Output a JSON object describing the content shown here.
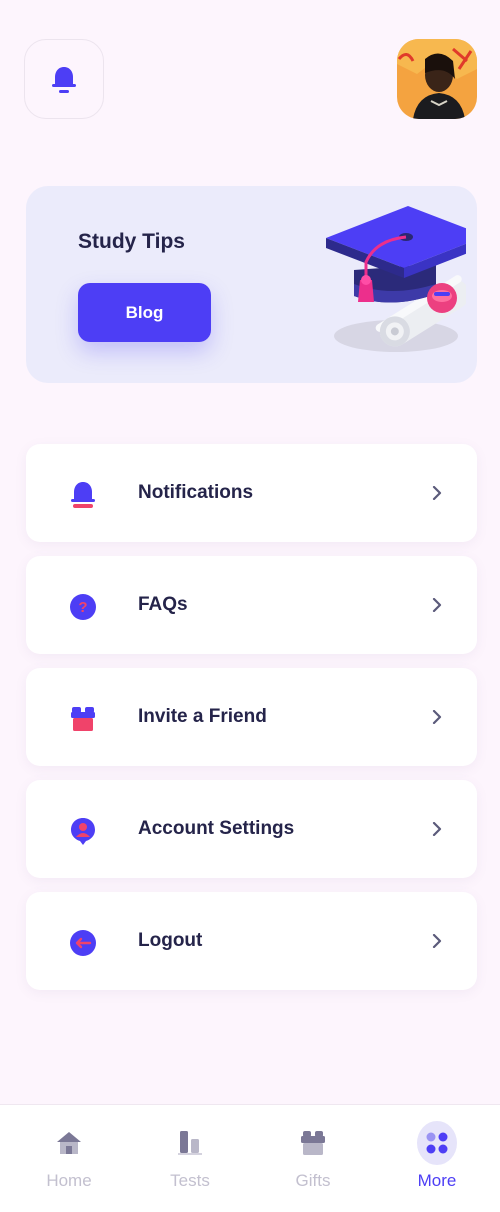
{
  "header": {
    "bell_icon": "bell-icon",
    "avatar_alt": "profile-photo"
  },
  "promo": {
    "title": "Study Tips",
    "button_label": "Blog",
    "illustration": "graduation-cap-and-diploma"
  },
  "menu": {
    "items": [
      {
        "label": "Notifications",
        "icon": "bell-icon"
      },
      {
        "label": "FAQs",
        "icon": "question-icon"
      },
      {
        "label": "Invite a Friend",
        "icon": "gift-icon"
      },
      {
        "label": "Account Settings",
        "icon": "user-pin-icon"
      },
      {
        "label": "Logout",
        "icon": "logout-icon"
      }
    ]
  },
  "tabbar": {
    "tabs": [
      {
        "label": "Home",
        "icon": "home-icon",
        "active": false
      },
      {
        "label": "Tests",
        "icon": "chart-icon",
        "active": false
      },
      {
        "label": "Gifts",
        "icon": "gift-icon",
        "active": false
      },
      {
        "label": "More",
        "icon": "grid-dots-icon",
        "active": true
      }
    ]
  },
  "colors": {
    "primary": "#4d3ef5",
    "accent": "#f0436a",
    "background": "#fdf5fd",
    "text": "#25244a",
    "inactive": "#c3c0cf"
  }
}
